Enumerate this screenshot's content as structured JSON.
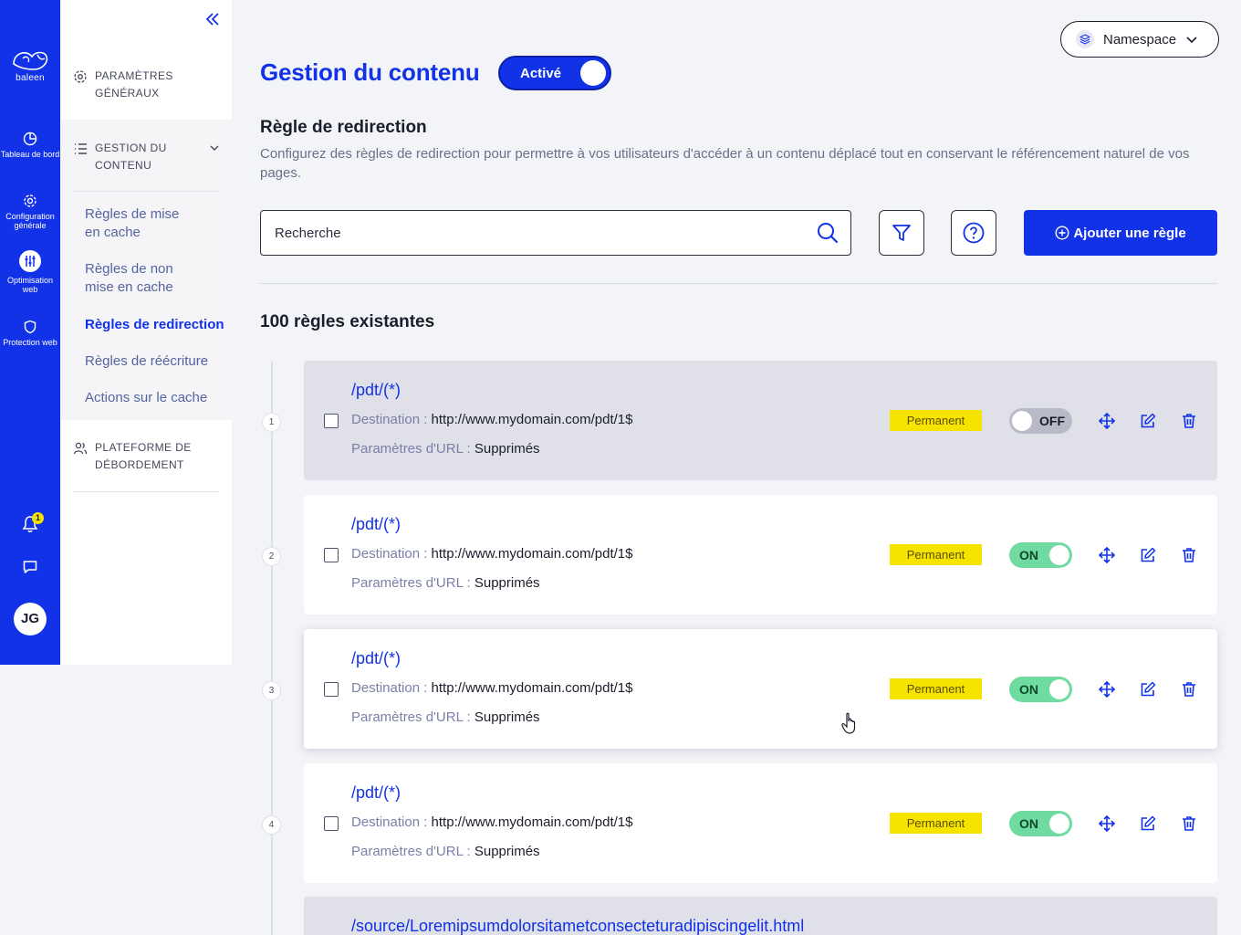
{
  "rail": {
    "logo_text": "baleen",
    "items": [
      {
        "label": "Tableau de bord",
        "icon": "dashboard-icon"
      },
      {
        "label": "Configuration générale",
        "icon": "gear-icon"
      },
      {
        "label": "Optimisation web",
        "icon": "sliders-icon"
      },
      {
        "label": "Protection web",
        "icon": "shield-icon"
      }
    ],
    "notifications": "1",
    "avatar": "JG"
  },
  "subnav": {
    "groups": [
      {
        "label": "PARAMÈTRES GÉNÉRAUX",
        "icon": "gear-icon"
      },
      {
        "label": "GESTION DU CONTENU",
        "icon": "list-icon"
      },
      {
        "label": "PLATEFORME DE DÉBORDEMENT",
        "icon": "users-icon"
      }
    ],
    "links": [
      {
        "label": "Règles de mise en cache"
      },
      {
        "label": "Règles de non mise en cache"
      },
      {
        "label": "Règles de redirection"
      },
      {
        "label": "Règles de réécriture"
      },
      {
        "label": "Actions sur le cache"
      }
    ]
  },
  "header": {
    "namespace": "Namespace",
    "title": "Gestion du contenu",
    "status": "Activé"
  },
  "section": {
    "title": "Règle de redirection",
    "description": "Configurez des règles de redirection pour permettre à vos utilisateurs d'accéder à un contenu déplacé tout en conservant le référencement naturel de vos pages."
  },
  "toolbar": {
    "search_placeholder": "Recherche",
    "add_label": "Ajouter une règle"
  },
  "count_label": "100 règles existantes",
  "labels": {
    "destination": "Destination : ",
    "params": "Paramètres d'URL : "
  },
  "rules": [
    {
      "index": "1",
      "path": "/pdt/(*)",
      "destination": "http://www.mydomain.com/pdt/1$",
      "params": "Supprimés",
      "type": "Permanent",
      "state": "OFF"
    },
    {
      "index": "2",
      "path": "/pdt/(*)",
      "destination": "http://www.mydomain.com/pdt/1$",
      "params": "Supprimés",
      "type": "Permanent",
      "state": "ON"
    },
    {
      "index": "3",
      "path": "/pdt/(*)",
      "destination": "http://www.mydomain.com/pdt/1$",
      "params": "Supprimés",
      "type": "Permanent",
      "state": "ON"
    },
    {
      "index": "4",
      "path": "/pdt/(*)",
      "destination": "http://www.mydomain.com/pdt/1$",
      "params": "Supprimés",
      "type": "Permanent",
      "state": "ON"
    },
    {
      "path": "/source/Loremipsumdolorsitametconsecteturadipiscingelit.html"
    }
  ],
  "colors": {
    "brand": "#1232e8",
    "badge": "#f7e300",
    "toggle_on": "#6fdba0",
    "toggle_off": "#b8bac8"
  }
}
